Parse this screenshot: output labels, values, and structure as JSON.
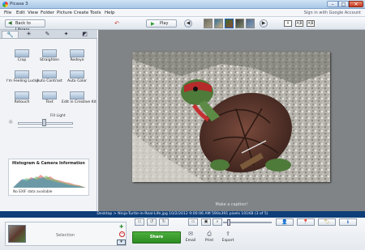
{
  "app": {
    "title": "Picasa 3"
  },
  "window": {
    "minimize": "–",
    "maximize": "□",
    "close": "✕"
  },
  "menu": [
    "File",
    "Edit",
    "View",
    "Folder",
    "Picture",
    "Create",
    "Tools",
    "Help"
  ],
  "signin": "Sign in with Google Account",
  "toolbar": {
    "back_label": "Back to Library",
    "play_label": "Play",
    "compare_labels": [
      "A",
      "A|B",
      "A|B"
    ]
  },
  "edit_tabs": [
    "wrench-icon",
    "tuning-icon",
    "brush-icon",
    "effects-icon",
    "more-effects-icon"
  ],
  "tools": [
    {
      "label": "Crop",
      "icon": "crop-icon"
    },
    {
      "label": "Straighten",
      "icon": "straighten-icon"
    },
    {
      "label": "Redeye",
      "icon": "redeye-icon"
    },
    {
      "label": "I'm Feeling Lucky",
      "icon": "feeling-lucky-icon"
    },
    {
      "label": "Auto Contrast",
      "icon": "auto-contrast-icon"
    },
    {
      "label": "Auto Color",
      "icon": "auto-color-icon"
    },
    {
      "label": "Retouch",
      "icon": "retouch-icon"
    },
    {
      "label": "Text",
      "icon": "text-icon"
    },
    {
      "label": "Edit in Creative Kit",
      "icon": "creative-kit-icon"
    }
  ],
  "fill_light": {
    "label": "Fill Light",
    "level": 0.45
  },
  "histogram": {
    "title": "Histogram & Camera Information",
    "exif": "No EXIF data available"
  },
  "caption": "Make a caption!",
  "info": "Desktop > Ninja-Turtle-in-Real-Life.jpg     10/2/2012 9:00:06 AM     590x391 pixels     101KB     (3 of 5)",
  "tray": {
    "label": "Selection"
  },
  "share": {
    "label": "Share"
  },
  "actions": [
    {
      "label": "Email",
      "icon": "email-icon"
    },
    {
      "label": "Print",
      "icon": "print-icon"
    },
    {
      "label": "Export",
      "icon": "export-icon"
    }
  ],
  "colors": {
    "title_bar": "#b9d3ee",
    "info_bar": "#0e3f78",
    "share": "#3b9e30",
    "viewer_bg": "#818486"
  }
}
